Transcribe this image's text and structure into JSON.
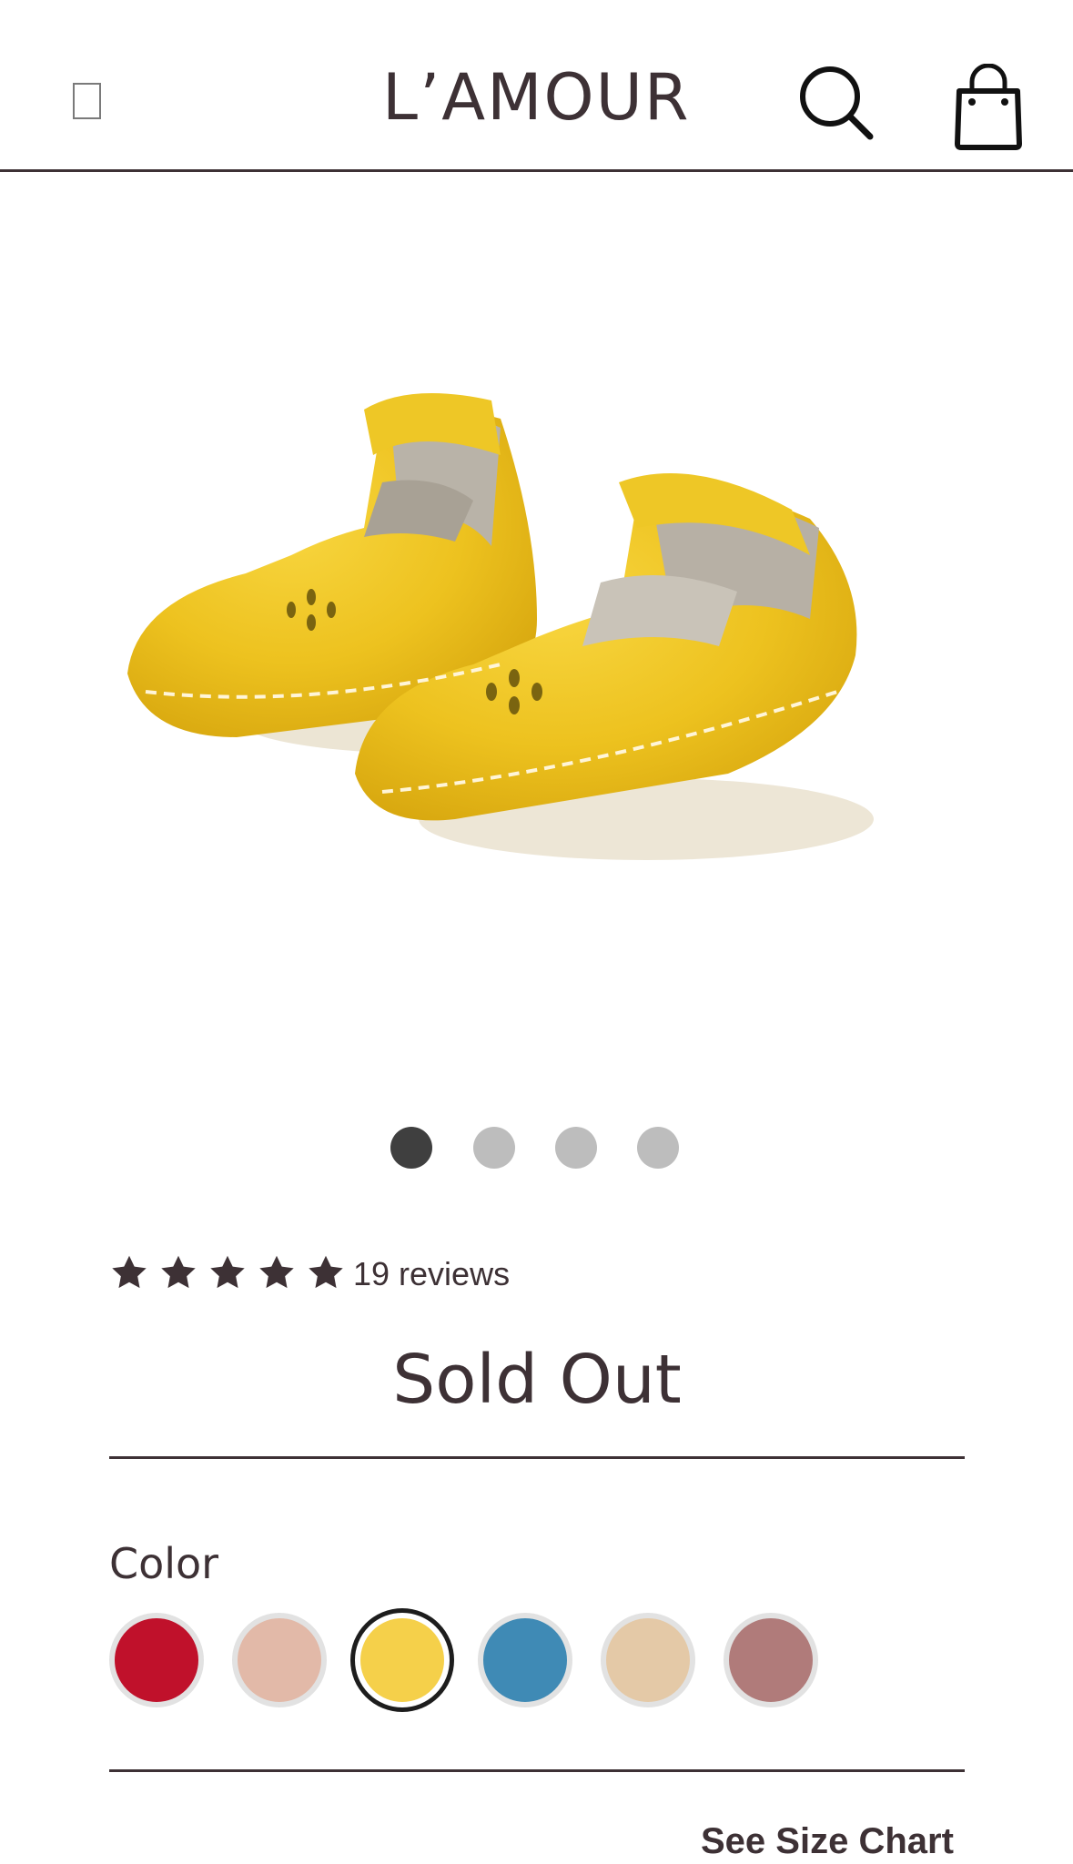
{
  "header": {
    "logo": "L’AMOUR",
    "menu_icon": "menu-icon",
    "search_icon": "search-icon",
    "bag_icon": "shopping-bag-icon"
  },
  "gallery": {
    "slide_count": 4,
    "active_slide": 1
  },
  "product": {
    "rating_stars": 5,
    "reviews": "19 reviews",
    "status": "Sold Out"
  },
  "color": {
    "label": "Color",
    "swatches": [
      {
        "color": "#c0112b",
        "selected": false
      },
      {
        "color": "#e2b9a8",
        "selected": false
      },
      {
        "color": "#f5d04a",
        "selected": true
      },
      {
        "color": "#3f8ab5",
        "selected": false
      },
      {
        "color": "#e4c9a7",
        "selected": false
      },
      {
        "color": "#b07b7a",
        "selected": false
      }
    ]
  },
  "size_chart_link": "See Size Chart"
}
